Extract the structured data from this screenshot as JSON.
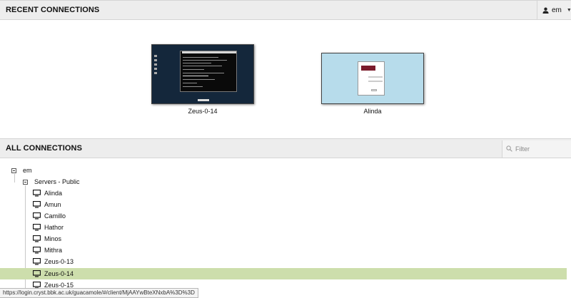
{
  "recent": {
    "title": "RECENT CONNECTIONS",
    "user_menu": {
      "name": "em",
      "user_icon": "user-icon",
      "caret_icon": "caret-down-icon"
    },
    "connections": [
      {
        "label": "Zeus-0-14",
        "thumbnail": "terminal-desktop"
      },
      {
        "label": "Alinda",
        "thumbnail": "login-window"
      }
    ]
  },
  "all": {
    "title": "ALL CONNECTIONS",
    "filter": {
      "placeholder": "Filter",
      "value": "",
      "icon": "search-icon"
    },
    "tree": {
      "root": {
        "label": "em",
        "expanded": true
      },
      "group": {
        "label": "Servers - Public",
        "expanded": true
      },
      "items": [
        {
          "label": "Alinda",
          "selected": false
        },
        {
          "label": "Amun",
          "selected": false
        },
        {
          "label": "Camillo",
          "selected": false
        },
        {
          "label": "Hathor",
          "selected": false
        },
        {
          "label": "Minos",
          "selected": false
        },
        {
          "label": "Mithra",
          "selected": false
        },
        {
          "label": "Zeus-0-13",
          "selected": false
        },
        {
          "label": "Zeus-0-14",
          "selected": true
        },
        {
          "label": "Zeus-0-15",
          "selected": false
        }
      ],
      "item_icon": "monitor-icon",
      "selected_color": "#cddeac"
    }
  },
  "status_bar": {
    "url": "https://login.cryst.bbk.ac.uk/guacamole/#/client/MjAAYwBteXNxbA%3D%3D"
  }
}
